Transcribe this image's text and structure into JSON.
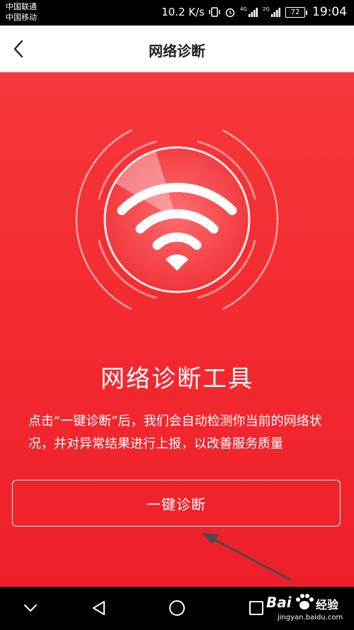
{
  "status_bar": {
    "carrier_1": "中国联通",
    "carrier_2": "中国移动",
    "speed": "10.2 K/s",
    "net_4g": "4G",
    "net_2g": "2G",
    "battery": "72",
    "time": "19:04"
  },
  "header": {
    "title": "网络诊断",
    "back_icon": "chevron-left-icon"
  },
  "main": {
    "tool_title": "网络诊断工具",
    "description": "点击“一键诊断”后，我们会自动检测你当前的网络状况，并对异常结果进行上报，以改善服务质量",
    "button_label": "一键诊断",
    "center_icon": "wifi-icon"
  },
  "nav_bar": {
    "icons": [
      "chevron-down-icon",
      "back-triangle-icon",
      "home-circle-icon",
      "recents-square-icon"
    ]
  },
  "watermark": {
    "brand": "Bai",
    "brand_cn": "经验",
    "url": "jingyan.baidu.com"
  },
  "colors": {
    "accent_red": "#f42a30",
    "header_bg": "#ffffff",
    "bar_bg": "#000000"
  }
}
